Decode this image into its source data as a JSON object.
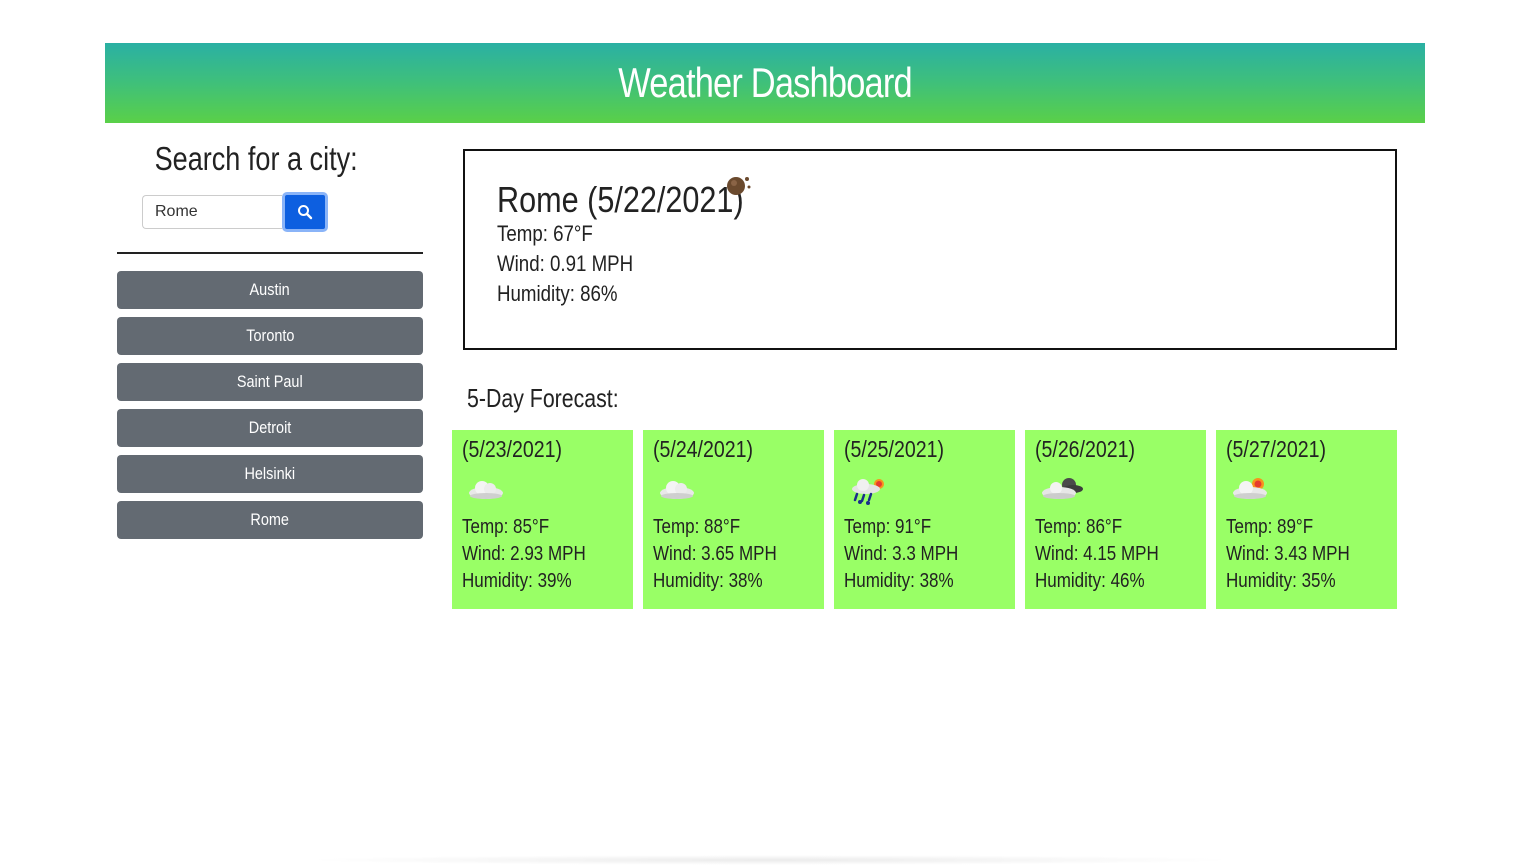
{
  "header": {
    "title": "Weather Dashboard"
  },
  "search": {
    "title": "Search for a city:",
    "input_value": "Rome",
    "button_icon": "search-icon"
  },
  "history": [
    "Austin",
    "Toronto",
    "Saint Paul",
    "Detroit",
    "Helsinki",
    "Rome"
  ],
  "current": {
    "title": "Rome (5/22/2021)",
    "icon": "weather-icon",
    "temp": "Temp: 67°F",
    "wind": "Wind: 0.91 MPH",
    "humidity": "Humidity: 86%"
  },
  "forecast": {
    "title": "5-Day Forecast:",
    "days": [
      {
        "date": "(5/23/2021)",
        "icon": "cloud-icon",
        "temp": "Temp: 85°F",
        "wind": "Wind: 2.93 MPH",
        "humidity": "Humidity: 39%"
      },
      {
        "date": "(5/24/2021)",
        "icon": "cloud-icon",
        "temp": "Temp: 88°F",
        "wind": "Wind: 3.65 MPH",
        "humidity": "Humidity: 38%"
      },
      {
        "date": "(5/25/2021)",
        "icon": "rain-sun-icon",
        "temp": "Temp: 91°F",
        "wind": "Wind: 3.3 MPH",
        "humidity": "Humidity: 38%"
      },
      {
        "date": "(5/26/2021)",
        "icon": "cloud-dark-icon",
        "temp": "Temp: 86°F",
        "wind": "Wind: 4.15 MPH",
        "humidity": "Humidity: 46%"
      },
      {
        "date": "(5/27/2021)",
        "icon": "cloud-sun-icon",
        "temp": "Temp: 89°F",
        "wind": "Wind: 3.43 MPH",
        "humidity": "Humidity: 35%"
      }
    ]
  },
  "colors": {
    "header_top": "#2ab0a4",
    "header_bottom": "#5ad048",
    "search_button": "#0d5fe0",
    "history_button": "#636a72",
    "forecast_card": "#99ff66"
  }
}
